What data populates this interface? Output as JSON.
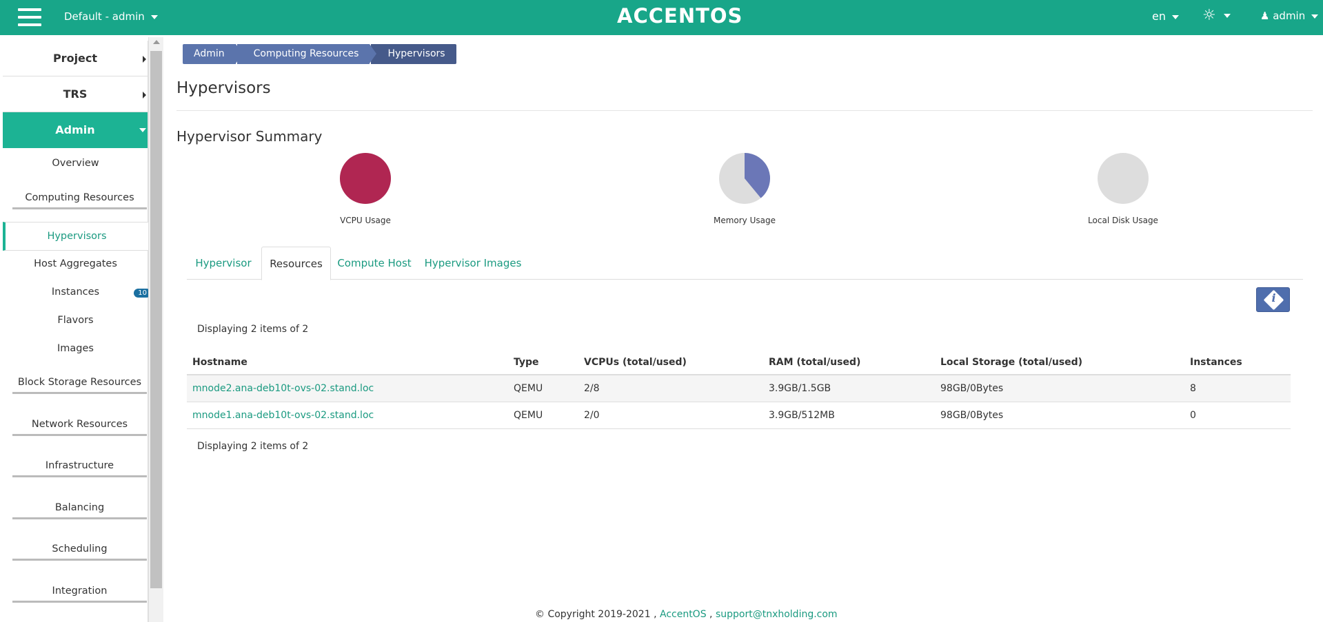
{
  "header": {
    "project_label": "Default - admin",
    "logo_text": "ACCENTOS",
    "language": "en",
    "user": "admin",
    "brand_color": "#18a689"
  },
  "sidebar": {
    "groups": [
      {
        "label": "Project"
      },
      {
        "label": "TRS"
      },
      {
        "label": "Admin"
      }
    ],
    "items": [
      {
        "label": "Overview"
      },
      {
        "label": "Computing Resources"
      },
      {
        "label": "Hypervisors"
      },
      {
        "label": "Host Aggregates"
      },
      {
        "label": "Instances",
        "badge": "10"
      },
      {
        "label": "Flavors"
      },
      {
        "label": "Images"
      },
      {
        "label": "Block Storage Resources"
      },
      {
        "label": "Network Resources"
      },
      {
        "label": "Infrastructure"
      },
      {
        "label": "Balancing"
      },
      {
        "label": "Scheduling"
      },
      {
        "label": "Integration"
      }
    ]
  },
  "breadcrumb": [
    "Admin",
    "Computing Resources",
    "Hypervisors"
  ],
  "page_title": "Hypervisors",
  "summary": {
    "title": "Hypervisor Summary",
    "charts": [
      {
        "label": "VCPU Usage",
        "used_fraction": 1.0,
        "color": "#b02652"
      },
      {
        "label": "Memory Usage",
        "used_fraction": 0.39,
        "color": "#6b77b7"
      },
      {
        "label": "Local Disk Usage",
        "used_fraction": 0.0,
        "color": "#dddddd"
      }
    ]
  },
  "tabs": [
    {
      "label": "Hypervisor"
    },
    {
      "label": "Resources"
    },
    {
      "label": "Compute Host"
    },
    {
      "label": "Hypervisor Images"
    }
  ],
  "table": {
    "count_text": "Displaying 2 items of 2",
    "columns": [
      "Hostname",
      "Type",
      "VCPUs (total/used)",
      "RAM (total/used)",
      "Local Storage (total/used)",
      "Instances"
    ],
    "rows": [
      [
        "mnode2.ana-deb10t-ovs-02.stand.loc",
        "QEMU",
        "2/8",
        "3.9GB/1.5GB",
        "98GB/0Bytes",
        "8"
      ],
      [
        "mnode1.ana-deb10t-ovs-02.stand.loc",
        "QEMU",
        "2/0",
        "3.9GB/512MB",
        "98GB/0Bytes",
        "0"
      ]
    ]
  },
  "footer": {
    "copyright": "© Copyright 2019-2021 ,",
    "brand_link": "AccentOS",
    "separator": ",",
    "email": "support@tnxholding.com"
  }
}
